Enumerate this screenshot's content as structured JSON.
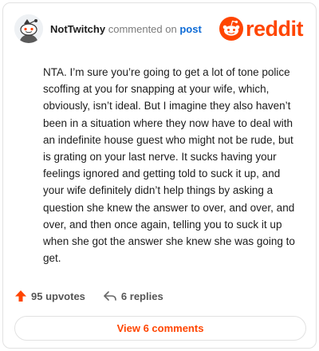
{
  "comment": {
    "username": "NotTwitchy",
    "commented_on": "commented on",
    "post_link": "post",
    "body": "NTA. I’m sure you’re going to get a lot of tone police scoffing at you for snapping at your wife, which, obviously, isn’t ideal. But I imagine they also haven’t been in a situation where they now have to deal with an indefinite house guest who might not be rude, but is grating on your last nerve. It sucks having your feelings ignored and getting told to suck it up, and your wife definitely didn’t help things by asking a question she knew the answer to over, and over, and over, and then once again, telling you to suck it up when she got the answer she knew she was going to get."
  },
  "brand": {
    "logo_text": "reddit",
    "color": "#ff4500"
  },
  "footer": {
    "upvotes": "95 upvotes",
    "replies": "6 replies"
  },
  "view_button": {
    "label": "View 6 comments"
  },
  "icons": {
    "avatar": "snoo-avatar-icon",
    "logo": "reddit-snoo-icon",
    "upvote": "upvote-arrow-icon",
    "reply": "reply-arrow-icon"
  }
}
